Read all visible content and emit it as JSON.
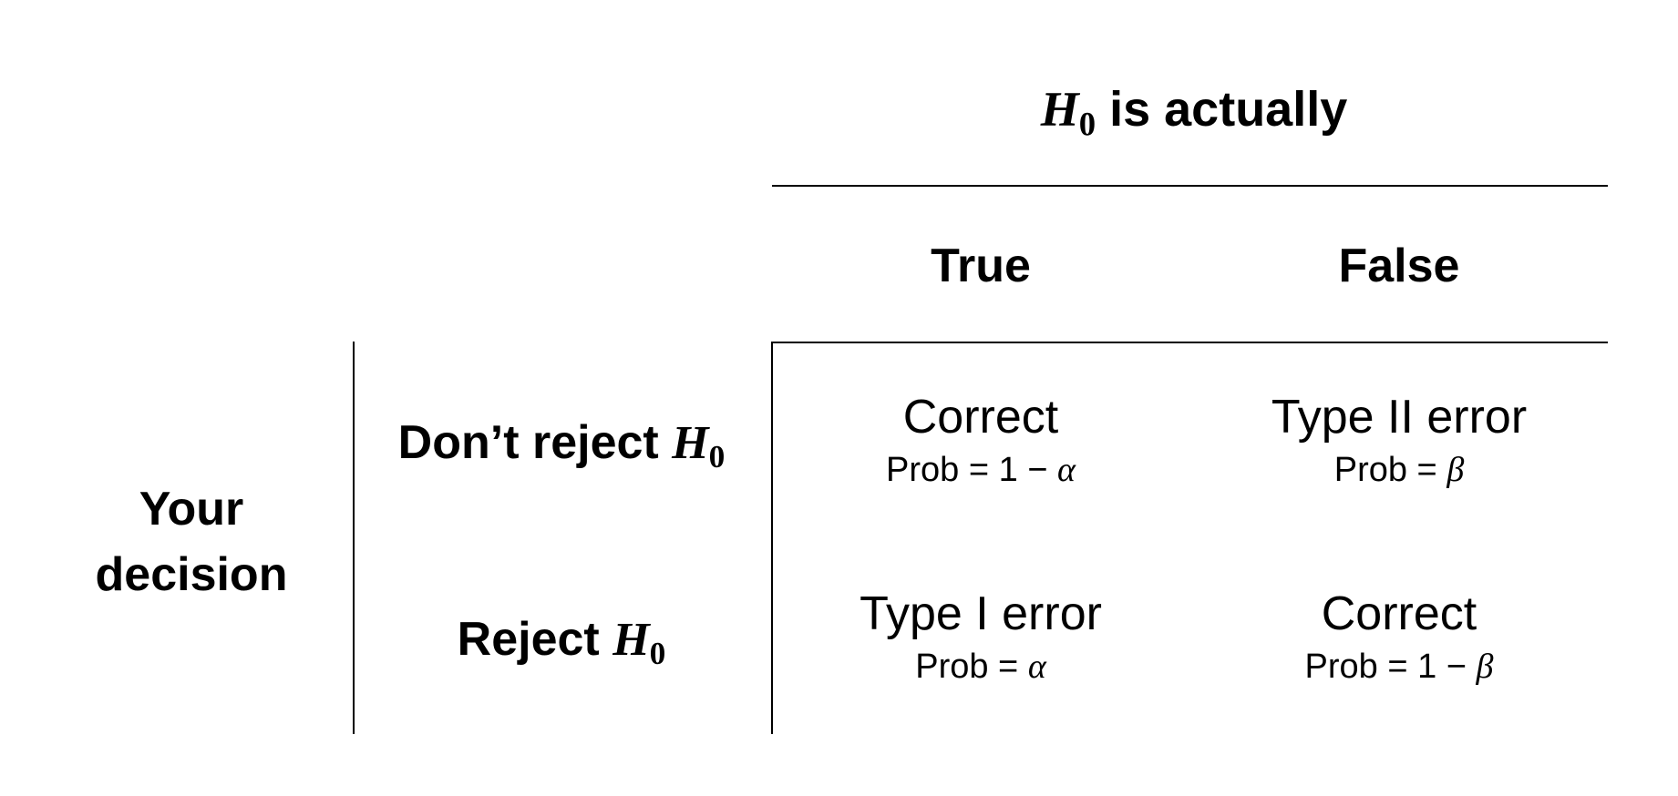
{
  "header": {
    "symbol_base": "H",
    "symbol_sub": "0",
    "text": " is actually"
  },
  "columns": [
    {
      "label": "True"
    },
    {
      "label": "False"
    }
  ],
  "side_label": {
    "line1": "Your",
    "line2": "decision"
  },
  "rows": [
    {
      "label_text": "Don’t reject ",
      "symbol_base": "H",
      "symbol_sub": "0"
    },
    {
      "label_text": "Reject ",
      "symbol_base": "H",
      "symbol_sub": "0"
    }
  ],
  "cells": [
    [
      {
        "outcome": "Correct",
        "prob_prefix": "Prob = 1 − ",
        "prob_symbol": "α"
      },
      {
        "outcome": "Type II error",
        "prob_prefix": "Prob = ",
        "prob_symbol": "β"
      }
    ],
    [
      {
        "outcome": "Type I error",
        "prob_prefix": "Prob = ",
        "prob_symbol": "α"
      },
      {
        "outcome": "Correct",
        "prob_prefix": "Prob = 1 − ",
        "prob_symbol": "β"
      }
    ]
  ]
}
